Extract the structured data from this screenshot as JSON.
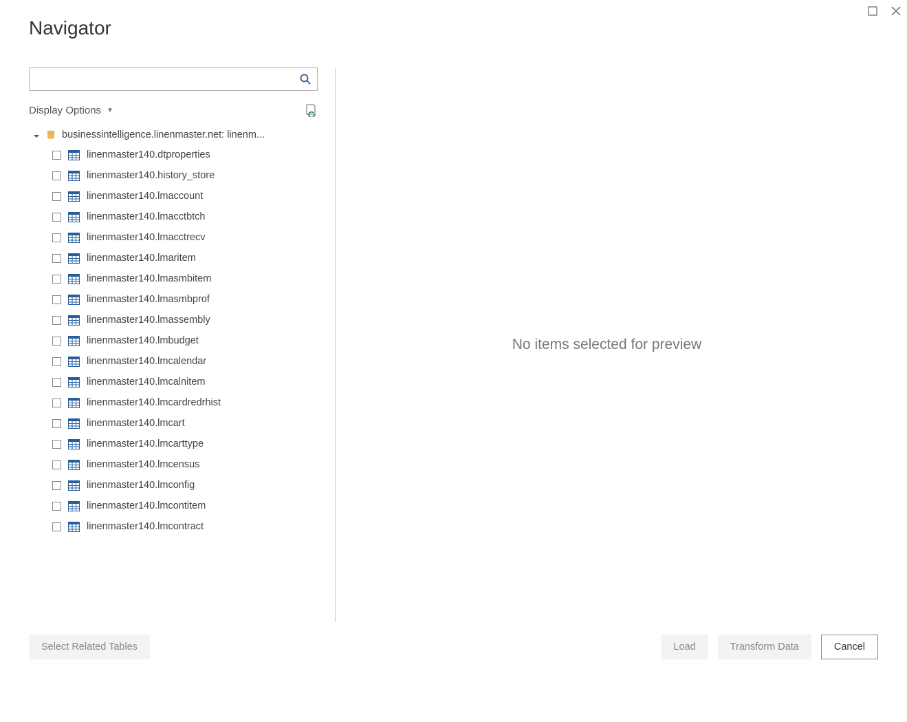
{
  "title": "Navigator",
  "search": {
    "value": "",
    "placeholder": ""
  },
  "display_options_label": "Display Options",
  "tree": {
    "root_label": "businessintelligence.linenmaster.net: linenm...",
    "items": [
      {
        "label": "linenmaster140.dtproperties"
      },
      {
        "label": "linenmaster140.history_store"
      },
      {
        "label": "linenmaster140.lmaccount"
      },
      {
        "label": "linenmaster140.lmacctbtch"
      },
      {
        "label": "linenmaster140.lmacctrecv"
      },
      {
        "label": "linenmaster140.lmaritem"
      },
      {
        "label": "linenmaster140.lmasmbitem"
      },
      {
        "label": "linenmaster140.lmasmbprof"
      },
      {
        "label": "linenmaster140.lmassembly"
      },
      {
        "label": "linenmaster140.lmbudget"
      },
      {
        "label": "linenmaster140.lmcalendar"
      },
      {
        "label": "linenmaster140.lmcalnitem"
      },
      {
        "label": "linenmaster140.lmcardredrhist"
      },
      {
        "label": "linenmaster140.lmcart"
      },
      {
        "label": "linenmaster140.lmcarttype"
      },
      {
        "label": "linenmaster140.lmcensus"
      },
      {
        "label": "linenmaster140.lmconfig"
      },
      {
        "label": "linenmaster140.lmcontitem"
      },
      {
        "label": "linenmaster140.lmcontract"
      }
    ]
  },
  "preview_message": "No items selected for preview",
  "buttons": {
    "select_related": "Select Related Tables",
    "load": "Load",
    "transform": "Transform Data",
    "cancel": "Cancel"
  }
}
